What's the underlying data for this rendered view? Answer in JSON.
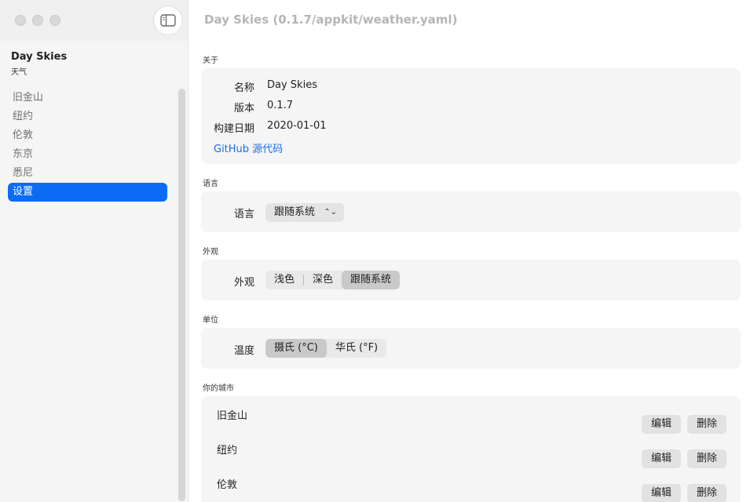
{
  "window": {
    "title": "Day Skies (0.1.7/appkit/weather.yaml)"
  },
  "sidebar": {
    "app_name": "Day Skies",
    "app_subtitle": "天气",
    "items": [
      {
        "label": "旧金山"
      },
      {
        "label": "纽约"
      },
      {
        "label": "伦敦"
      },
      {
        "label": "东京"
      },
      {
        "label": "悉尼"
      },
      {
        "label": "设置",
        "selected": true
      }
    ]
  },
  "about": {
    "section_label": "关于",
    "name_label": "名称",
    "name_value": "Day Skies",
    "version_label": "版本",
    "version_value": "0.1.7",
    "build_label": "构建日期",
    "build_value": "2020-01-01",
    "source_link": "GitHub 源代码"
  },
  "language": {
    "section_label": "语言",
    "row_label": "语言",
    "selected": "跟随系统"
  },
  "appearance": {
    "section_label": "外观",
    "row_label": "外观",
    "options": [
      "浅色",
      "深色",
      "跟随系统"
    ],
    "selected": "跟随系统"
  },
  "units": {
    "section_label": "单位",
    "row_label": "温度",
    "options": [
      "摄氏 (°C)",
      "华氏 (°F)"
    ],
    "selected": "摄氏 (°C)"
  },
  "cities": {
    "section_label": "你的城市",
    "edit_label": "编辑",
    "delete_label": "删除",
    "rows": [
      {
        "name": "旧金山"
      },
      {
        "name": "纽约"
      },
      {
        "name": "伦敦"
      }
    ]
  },
  "colors": {
    "accent": "#0a6cf5",
    "link": "#1a6fe8",
    "sidebar_bg": "#f5f5f5",
    "card_bg": "#f5f5f5"
  }
}
